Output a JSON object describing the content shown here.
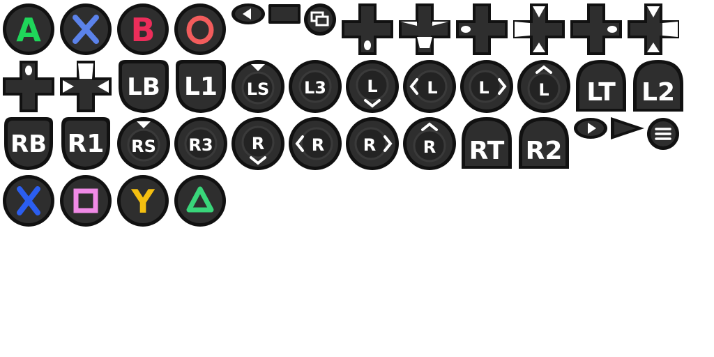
{
  "colors": {
    "outline": "#111111",
    "body": "#2e2e2e",
    "inner": "#232323",
    "ring": "#3a3a3a",
    "white": "#ffffff",
    "xbox_a": "#1fd65a",
    "xbox_x": "#5b82ea",
    "xbox_b": "#ec2d5a",
    "ps_circle": "#f25c5c",
    "ps_cross": "#2b5ef0",
    "ps_square": "#f08ae6",
    "xbox_y": "#f4bf10",
    "ps_triangle": "#39d67a"
  },
  "face_buttons": {
    "xbox_a": "A",
    "xbox_b": "B",
    "xbox_y": "Y"
  },
  "bumpers": {
    "lb": "LB",
    "l1": "L1",
    "rb": "RB",
    "r1": "R1"
  },
  "triggers": {
    "lt": "LT",
    "l2": "L2",
    "rt": "RT",
    "r2": "R2"
  },
  "sticks": {
    "ls": "LS",
    "l3": "L3",
    "l": "L",
    "rs": "RS",
    "r3": "R3",
    "r": "R"
  },
  "icons": [
    "xbox-a-button-icon",
    "xbox-x-button-icon",
    "xbox-b-button-icon",
    "ps-circle-button-icon",
    "view-button-icon",
    "touchpad-icon",
    "xbox-view-button-icon",
    "dpad-icon",
    "dpad-diagonal-icon",
    "dpad-left-right-icon",
    "dpad-diagonal-left-right-icon",
    "dpad-horizontal-icon",
    "dpad-diagonal-right-icon",
    "dpad-up-icon",
    "dpad-diagonal-up-icon",
    "menu-button-icon",
    "start-button-icon",
    "options-button-icon",
    "ps-cross-button-icon",
    "ps-square-button-icon",
    "xbox-y-button-icon",
    "ps-triangle-button-icon"
  ]
}
